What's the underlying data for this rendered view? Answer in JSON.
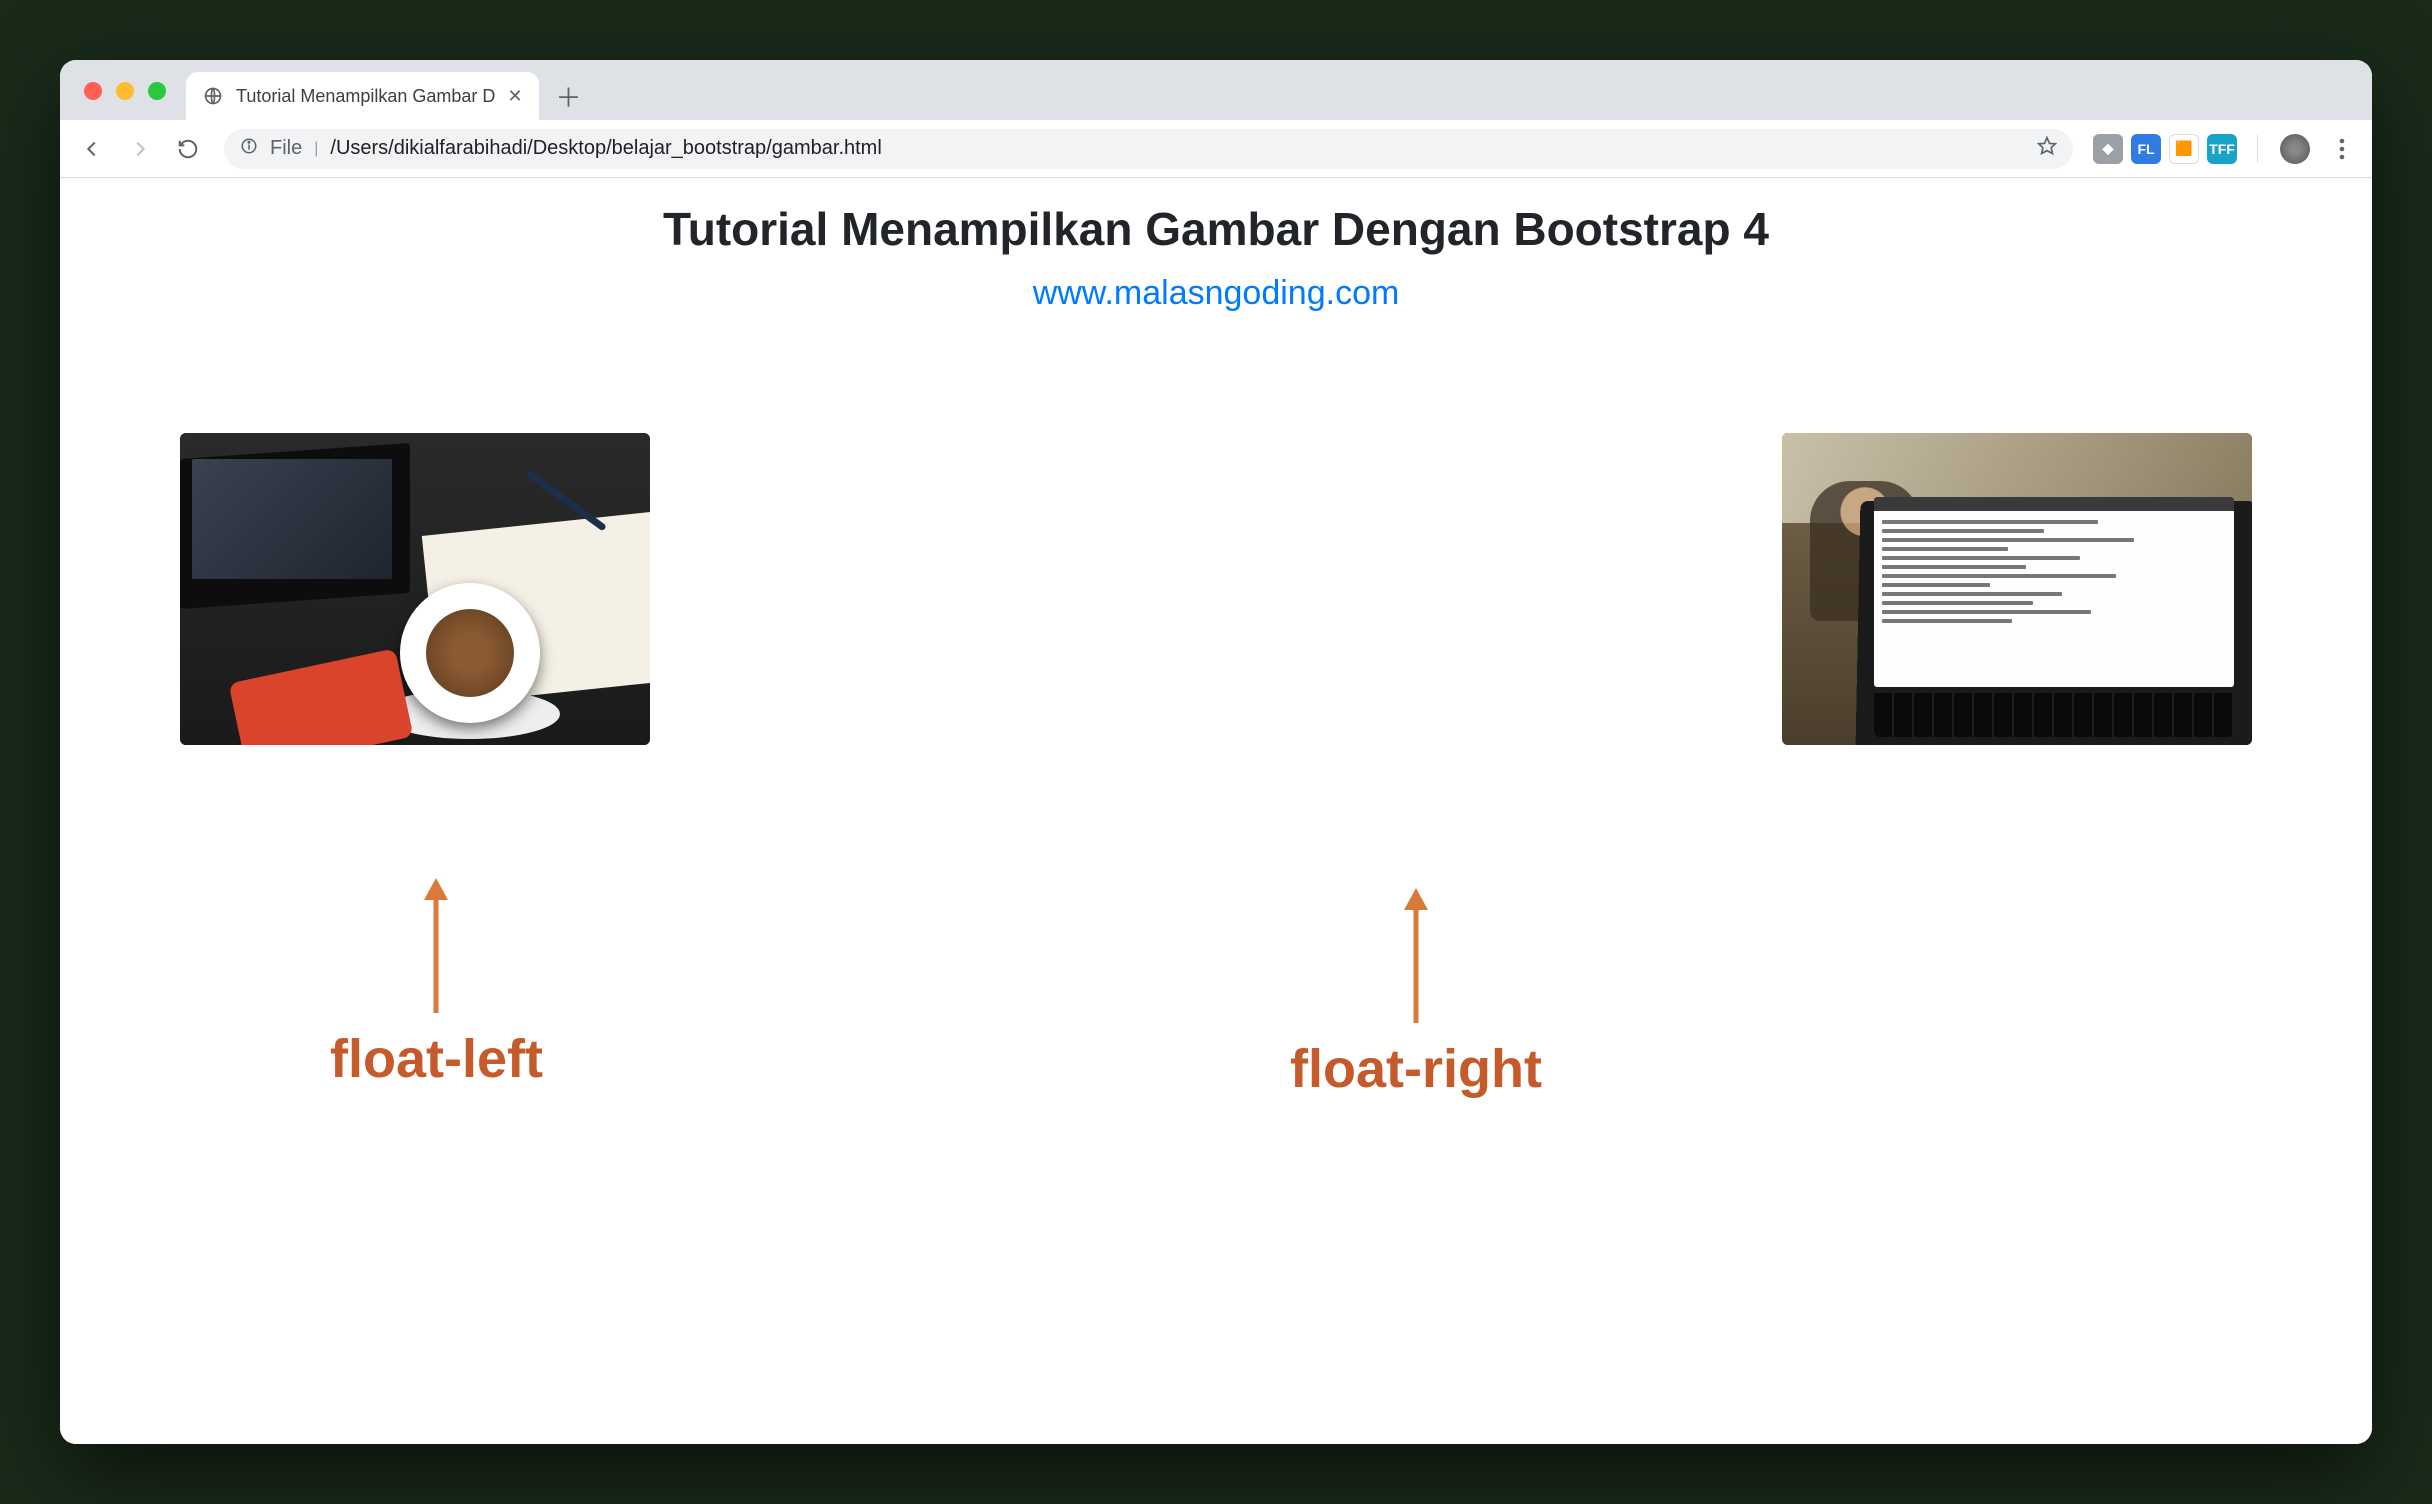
{
  "browser": {
    "tab": {
      "title": "Tutorial Menampilkan Gambar D",
      "favicon": "globe-icon"
    },
    "toolbar": {
      "url_prefix": "File",
      "url": "/Users/dikialfarabihadi/Desktop/belajar_bootstrap/gambar.html"
    },
    "extensions": [
      {
        "name": "ext-diamond",
        "bg": "#9aa0a6",
        "label": "◆"
      },
      {
        "name": "ext-fl",
        "bg": "#2f7de1",
        "label": "FL"
      },
      {
        "name": "ext-colorpick",
        "bg": "#ffffff",
        "label": "🟧"
      },
      {
        "name": "ext-tff",
        "bg": "#1aa3c9",
        "label": "TFF"
      }
    ]
  },
  "page": {
    "title": "Tutorial Menampilkan Gambar Dengan Bootstrap 4",
    "subtitle": "www.malasngoding.com",
    "images": {
      "left_alt": "workspace with laptop, coffee and notebook",
      "right_alt": "laptop with code in a cafe"
    }
  },
  "annotations": {
    "left": "float-left",
    "right": "float-right"
  },
  "colors": {
    "link": "#007bff",
    "annotation": "#c55a2b"
  }
}
